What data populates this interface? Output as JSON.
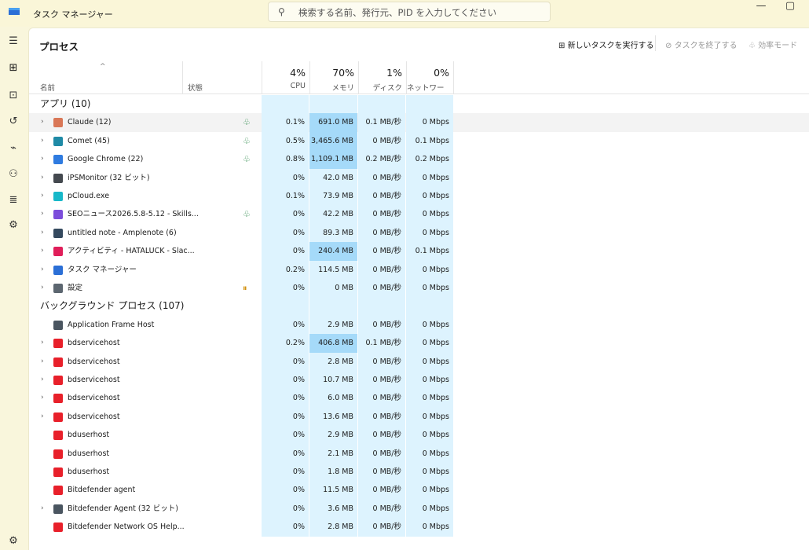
{
  "window": {
    "title": "タスク マネージャー",
    "search_placeholder": "検索する名前、発行元、PID を入力してください",
    "min_glyph": "—",
    "max_glyph": "▢"
  },
  "nav": {
    "items": [
      "menu-icon",
      "processes-icon",
      "performance-icon",
      "app-history-icon",
      "startup-icon",
      "users-icon",
      "details-icon",
      "services-icon",
      "settings-icon"
    ]
  },
  "page": {
    "title": "プロセス",
    "toolbar": {
      "new_task": "新しいタスクを実行する",
      "end_task": "タスクを終了する",
      "efficiency": "効率モード"
    }
  },
  "columns": {
    "name": "名前",
    "status": "状態",
    "cpu": {
      "pct": "4%",
      "label": "CPU"
    },
    "memory": {
      "pct": "70%",
      "label": "メモリ"
    },
    "disk": {
      "pct": "1%",
      "label": "ディスク"
    },
    "network": {
      "pct": "0%",
      "label": "ネットワーク"
    }
  },
  "groups": {
    "apps": "アプリ (10)",
    "background": "バックグラウンド プロセス (107)"
  },
  "apps": [
    {
      "name": "Claude (12)",
      "icon": "claude-icon",
      "color": "#d97757",
      "expand": true,
      "status": "eco",
      "cpu": "0.1%",
      "mem": "691.0 MB",
      "disk": "0.1 MB/秒",
      "net": "0 Mbps",
      "hi": true,
      "selected": true
    },
    {
      "name": "Comet (45)",
      "icon": "comet-icon",
      "color": "#1f8aa6",
      "expand": true,
      "status": "eco",
      "cpu": "0.5%",
      "mem": "3,465.6 MB",
      "disk": "0 MB/秒",
      "net": "0.1 Mbps",
      "hi": true
    },
    {
      "name": "Google Chrome (22)",
      "icon": "chrome-icon",
      "color": "#2f7be0",
      "expand": true,
      "status": "eco",
      "cpu": "0.8%",
      "mem": "1,109.1 MB",
      "disk": "0.2 MB/秒",
      "net": "0.2 Mbps",
      "hi": true
    },
    {
      "name": "iPSMonitor (32 ビット)",
      "icon": "ipsmonitor-icon",
      "color": "#44494f",
      "expand": true,
      "status": "",
      "cpu": "0%",
      "mem": "42.0 MB",
      "disk": "0 MB/秒",
      "net": "0 Mbps"
    },
    {
      "name": "pCloud.exe",
      "icon": "pcloud-icon",
      "color": "#17b8c9",
      "expand": true,
      "status": "",
      "cpu": "0.1%",
      "mem": "73.9 MB",
      "disk": "0 MB/秒",
      "net": "0 Mbps"
    },
    {
      "name": "SEOニュース2026.5.8-5.12 - Skills...",
      "icon": "obsidian-icon",
      "color": "#7c4ddb",
      "expand": true,
      "status": "eco",
      "cpu": "0%",
      "mem": "42.2 MB",
      "disk": "0 MB/秒",
      "net": "0 Mbps"
    },
    {
      "name": "untitled note - Amplenote (6)",
      "icon": "amplenote-icon",
      "color": "#34495e",
      "expand": true,
      "status": "",
      "cpu": "0%",
      "mem": "89.3 MB",
      "disk": "0 MB/秒",
      "net": "0 Mbps"
    },
    {
      "name": "アクティビティ - HATALUCK - Slac...",
      "icon": "slack-icon",
      "color": "#e01e5a",
      "expand": true,
      "status": "",
      "cpu": "0%",
      "mem": "240.4 MB",
      "disk": "0 MB/秒",
      "net": "0.1 Mbps",
      "hi": true
    },
    {
      "name": "タスク マネージャー",
      "icon": "taskmanager-icon",
      "color": "#2b6fd6",
      "expand": true,
      "status": "",
      "cpu": "0.2%",
      "mem": "114.5 MB",
      "disk": "0 MB/秒",
      "net": "0 Mbps"
    },
    {
      "name": "設定",
      "icon": "settings-gear-icon",
      "color": "#5c6670",
      "expand": true,
      "status": "pause",
      "cpu": "0%",
      "mem": "0 MB",
      "disk": "0 MB/秒",
      "net": "0 Mbps"
    }
  ],
  "background": [
    {
      "name": "Application Frame Host",
      "icon": "appframe-icon",
      "color": "#4a5560",
      "expand": false,
      "cpu": "0%",
      "mem": "2.9 MB",
      "disk": "0 MB/秒",
      "net": "0 Mbps"
    },
    {
      "name": "bdservicehost",
      "icon": "bitdefender-icon",
      "color": "#e8202a",
      "expand": true,
      "cpu": "0.2%",
      "mem": "406.8 MB",
      "disk": "0.1 MB/秒",
      "net": "0 Mbps",
      "hi": true
    },
    {
      "name": "bdservicehost",
      "icon": "bitdefender-icon",
      "color": "#e8202a",
      "expand": true,
      "cpu": "0%",
      "mem": "2.8 MB",
      "disk": "0 MB/秒",
      "net": "0 Mbps"
    },
    {
      "name": "bdservicehost",
      "icon": "bitdefender-icon",
      "color": "#e8202a",
      "expand": true,
      "cpu": "0%",
      "mem": "10.7 MB",
      "disk": "0 MB/秒",
      "net": "0 Mbps"
    },
    {
      "name": "bdservicehost",
      "icon": "bitdefender-icon",
      "color": "#e8202a",
      "expand": true,
      "cpu": "0%",
      "mem": "6.0 MB",
      "disk": "0 MB/秒",
      "net": "0 Mbps"
    },
    {
      "name": "bdservicehost",
      "icon": "bitdefender-icon",
      "color": "#e8202a",
      "expand": true,
      "cpu": "0%",
      "mem": "13.6 MB",
      "disk": "0 MB/秒",
      "net": "0 Mbps"
    },
    {
      "name": "bduserhost",
      "icon": "bitdefender-icon",
      "color": "#e8202a",
      "expand": false,
      "cpu": "0%",
      "mem": "2.9 MB",
      "disk": "0 MB/秒",
      "net": "0 Mbps"
    },
    {
      "name": "bduserhost",
      "icon": "bitdefender-icon",
      "color": "#e8202a",
      "expand": false,
      "cpu": "0%",
      "mem": "2.1 MB",
      "disk": "0 MB/秒",
      "net": "0 Mbps"
    },
    {
      "name": "bduserhost",
      "icon": "bitdefender-icon",
      "color": "#e8202a",
      "expand": false,
      "cpu": "0%",
      "mem": "1.8 MB",
      "disk": "0 MB/秒",
      "net": "0 Mbps"
    },
    {
      "name": "Bitdefender agent",
      "icon": "bitdefender-icon",
      "color": "#e8202a",
      "expand": false,
      "cpu": "0%",
      "mem": "11.5 MB",
      "disk": "0 MB/秒",
      "net": "0 Mbps"
    },
    {
      "name": "Bitdefender Agent (32 ビット)",
      "icon": "appframe-icon",
      "color": "#4a5560",
      "expand": true,
      "cpu": "0%",
      "mem": "3.6 MB",
      "disk": "0 MB/秒",
      "net": "0 Mbps"
    },
    {
      "name": "Bitdefender Network OS Help...",
      "icon": "bitdefender-icon",
      "color": "#e8202a",
      "expand": false,
      "cpu": "0%",
      "mem": "2.8 MB",
      "disk": "0 MB/秒",
      "net": "0 Mbps"
    }
  ]
}
